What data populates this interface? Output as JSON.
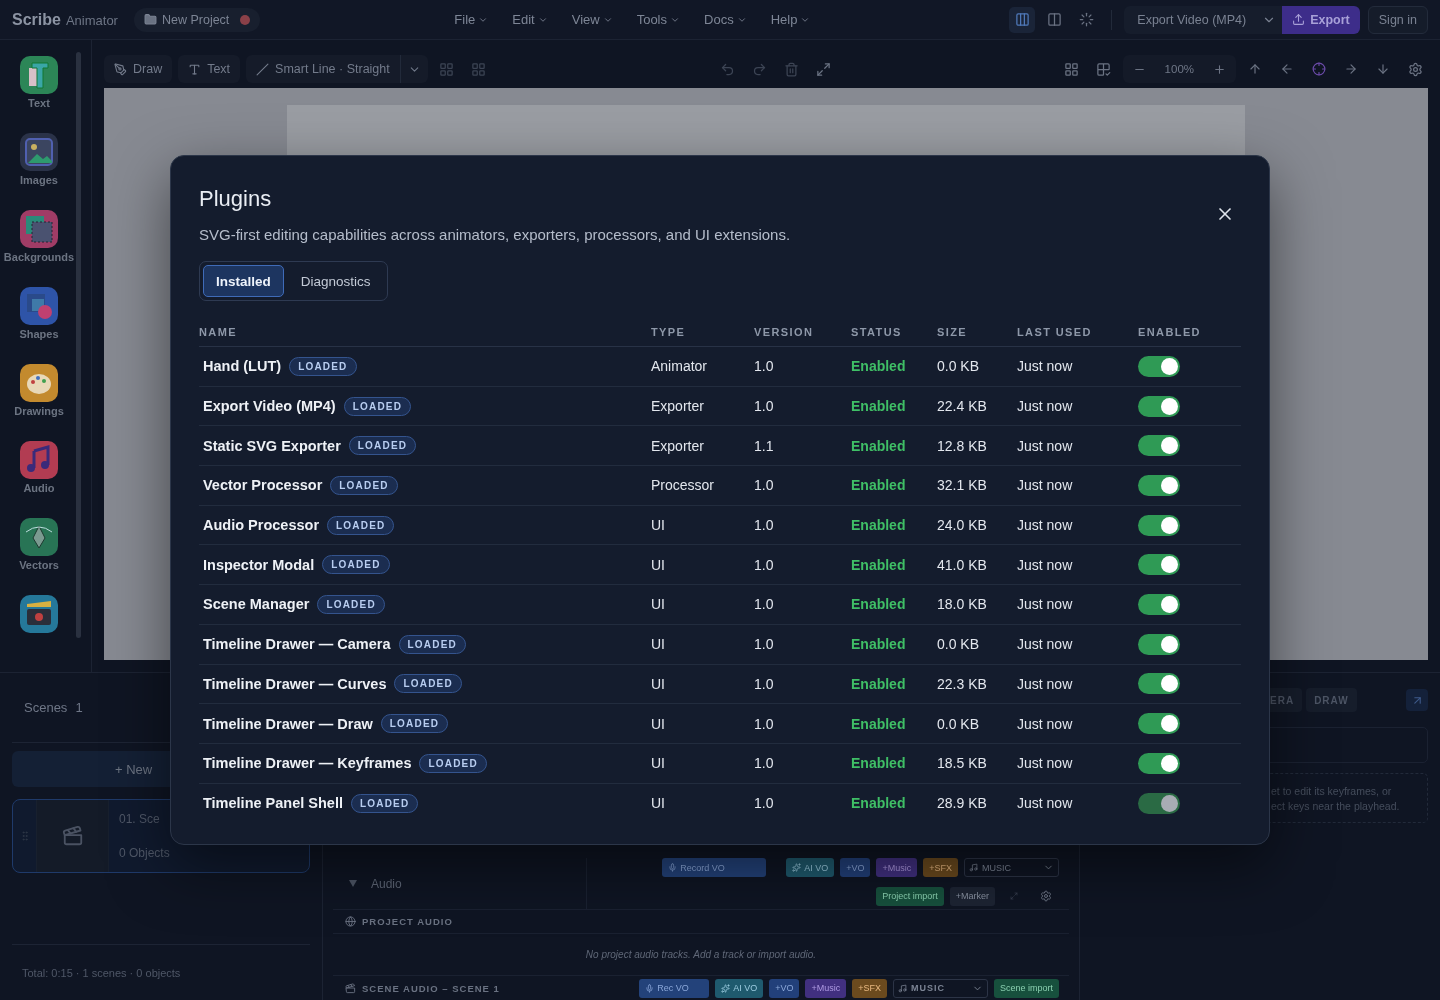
{
  "topbar": {
    "brand": "Scribe",
    "brand_sub": "Animator",
    "project": "New Project",
    "unsaved": true,
    "menus": [
      "File",
      "Edit",
      "View",
      "Tools",
      "Docs",
      "Help"
    ],
    "view_modes": [
      {
        "kind": "split",
        "selected": true
      },
      {
        "kind": "columns",
        "selected": false
      },
      {
        "kind": "focus",
        "selected": false
      }
    ],
    "export_format": "Export Video (MP4)",
    "export_button": "Export",
    "sign_in": "Sign in"
  },
  "rail": {
    "items": [
      {
        "kind": "text",
        "label": "Text"
      },
      {
        "kind": "images",
        "label": "Images"
      },
      {
        "kind": "backgrounds",
        "label": "Backgrounds"
      },
      {
        "kind": "shapes",
        "label": "Shapes"
      },
      {
        "kind": "drawings",
        "label": "Drawings"
      },
      {
        "kind": "audio",
        "label": "Audio"
      },
      {
        "kind": "vectors",
        "label": "Vectors"
      },
      {
        "kind": "scenes"
      }
    ]
  },
  "toolbar": {
    "draw": "Draw",
    "text": "Text",
    "line_mode": "Smart Line · Straight",
    "zoom": "100%"
  },
  "scenes": {
    "title": "Scenes",
    "count": "1",
    "new_button": "+ New",
    "scene": {
      "title": "01. Sce",
      "objects": "0 Objects",
      "selected": true
    },
    "total": "Total: 0:15 · 1 scenes · 0 objects"
  },
  "audio": {
    "title": "Audio",
    "record": "Record VO",
    "buttons": [
      {
        "kind": "ai",
        "label": "AI VO"
      },
      {
        "kind": "vo",
        "label": "+VO"
      },
      {
        "kind": "music",
        "label": "+Music"
      },
      {
        "kind": "sfx",
        "label": "+SFX"
      }
    ],
    "music_select": "MUSIC",
    "project_import": "Project import",
    "marker": "+Marker",
    "project_section": "PROJECT AUDIO",
    "empty": "No project audio tracks. Add a track or import audio.",
    "scene_section": "SCENE AUDIO – SCENE 1",
    "scene_record": "Rec VO",
    "scene_buttons": [
      {
        "kind": "ai",
        "label": "AI VO"
      },
      {
        "kind": "vo",
        "label": "+VO"
      },
      {
        "kind": "music",
        "label": "+Music"
      },
      {
        "kind": "sfx",
        "label": "+SFX"
      }
    ],
    "scene_music_select": "MUSIC",
    "scene_import": "Scene import"
  },
  "inspector": {
    "tabs": [
      {
        "label": "ERA",
        "selected": false
      },
      {
        "label": "DRAW",
        "selected": false
      }
    ],
    "hint_lines": [
      "et to edit its keyframes, or",
      "ect keys near the playhead."
    ]
  },
  "modal": {
    "title": "Plugins",
    "subtitle": "SVG-first editing capabilities across animators, exporters, processors, and UI extensions.",
    "tabs": [
      {
        "label": "Installed",
        "selected": true
      },
      {
        "label": "Diagnostics",
        "selected": false
      }
    ],
    "columns": [
      "NAME",
      "TYPE",
      "VERSION",
      "STATUS",
      "SIZE",
      "LAST USED",
      "ENABLED"
    ],
    "rows": [
      {
        "name": "Hand (LUT)",
        "badge": "LOADED",
        "type": "Animator",
        "version": "1.0",
        "status": "Enabled",
        "size": "0.0 KB",
        "last_used": "Just now",
        "on": true,
        "disabled": false
      },
      {
        "name": "Export Video (MP4)",
        "badge": "LOADED",
        "type": "Exporter",
        "version": "1.0",
        "status": "Enabled",
        "size": "22.4 KB",
        "last_used": "Just now",
        "on": true,
        "disabled": false
      },
      {
        "name": "Static SVG Exporter",
        "badge": "LOADED",
        "type": "Exporter",
        "version": "1.1",
        "status": "Enabled",
        "size": "12.8 KB",
        "last_used": "Just now",
        "on": true,
        "disabled": false
      },
      {
        "name": "Vector Processor",
        "badge": "LOADED",
        "type": "Processor",
        "version": "1.0",
        "status": "Enabled",
        "size": "32.1 KB",
        "last_used": "Just now",
        "on": true,
        "disabled": false
      },
      {
        "name": "Audio Processor",
        "badge": "LOADED",
        "type": "UI",
        "version": "1.0",
        "status": "Enabled",
        "size": "24.0 KB",
        "last_used": "Just now",
        "on": true,
        "disabled": false
      },
      {
        "name": "Inspector Modal",
        "badge": "LOADED",
        "type": "UI",
        "version": "1.0",
        "status": "Enabled",
        "size": "41.0 KB",
        "last_used": "Just now",
        "on": true,
        "disabled": false
      },
      {
        "name": "Scene Manager",
        "badge": "LOADED",
        "type": "UI",
        "version": "1.0",
        "status": "Enabled",
        "size": "18.0 KB",
        "last_used": "Just now",
        "on": true,
        "disabled": false
      },
      {
        "name": "Timeline Drawer — Camera",
        "badge": "LOADED",
        "type": "UI",
        "version": "1.0",
        "status": "Enabled",
        "size": "0.0 KB",
        "last_used": "Just now",
        "on": true,
        "disabled": false
      },
      {
        "name": "Timeline Drawer — Curves",
        "badge": "LOADED",
        "type": "UI",
        "version": "1.0",
        "status": "Enabled",
        "size": "22.3 KB",
        "last_used": "Just now",
        "on": true,
        "disabled": false
      },
      {
        "name": "Timeline Drawer — Draw",
        "badge": "LOADED",
        "type": "UI",
        "version": "1.0",
        "status": "Enabled",
        "size": "0.0 KB",
        "last_used": "Just now",
        "on": true,
        "disabled": false
      },
      {
        "name": "Timeline Drawer — Keyframes",
        "badge": "LOADED",
        "type": "UI",
        "version": "1.0",
        "status": "Enabled",
        "size": "18.5 KB",
        "last_used": "Just now",
        "on": true,
        "disabled": false
      },
      {
        "name": "Timeline Panel Shell",
        "badge": "LOADED",
        "type": "UI",
        "version": "1.0",
        "status": "Enabled",
        "size": "28.9 KB",
        "last_used": "Just now",
        "on": true,
        "disabled": true
      }
    ]
  }
}
